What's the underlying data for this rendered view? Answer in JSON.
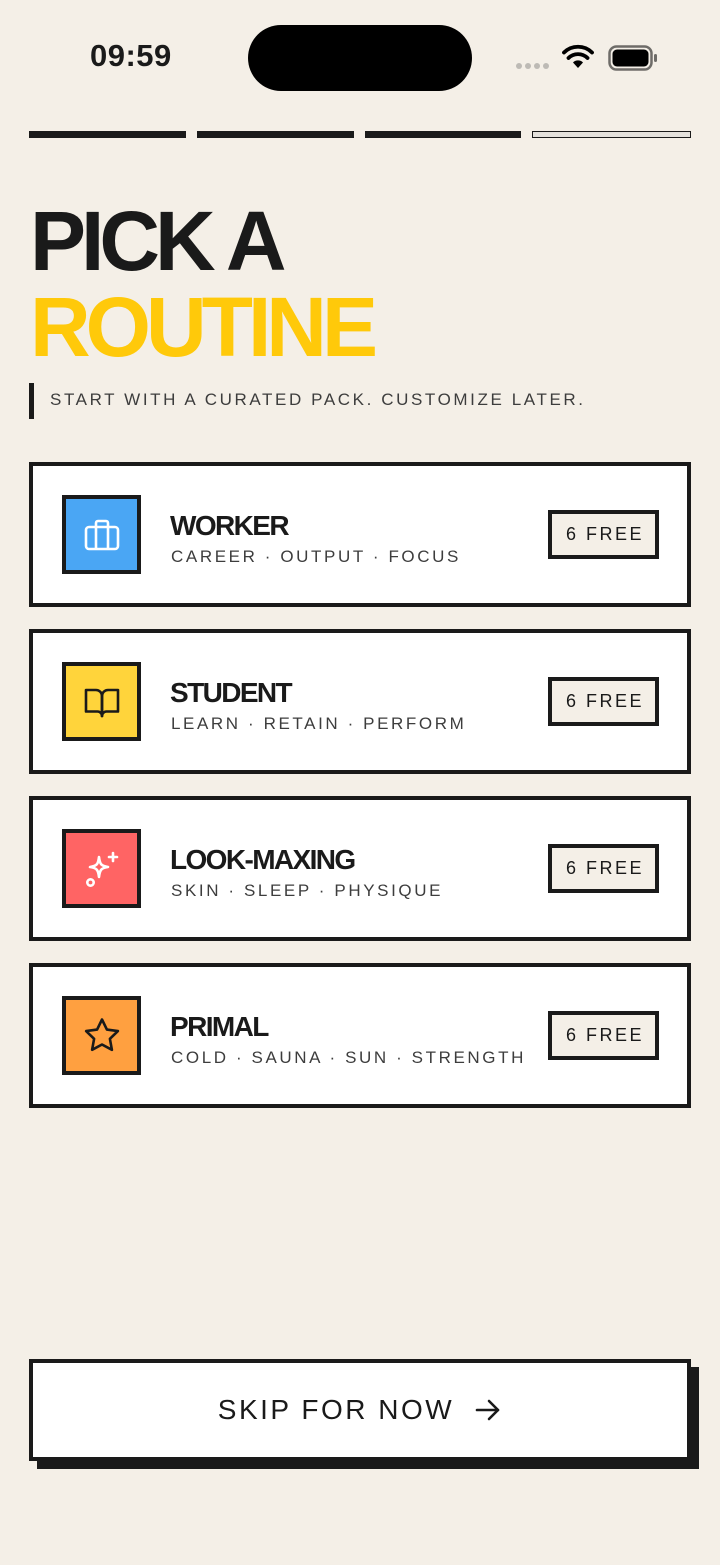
{
  "status_bar": {
    "time": "09:59"
  },
  "progress": {
    "total_steps": 4,
    "completed_steps": 3
  },
  "header": {
    "title_line1": "PICK A",
    "title_line2": "ROUTINE",
    "subtitle": "START WITH A CURATED PACK. CUSTOMIZE LATER."
  },
  "routines": [
    {
      "name": "WORKER",
      "tags": "CAREER · OUTPUT · FOCUS",
      "badge": "6 FREE",
      "icon": "briefcase-icon",
      "color": "#4aa6f4"
    },
    {
      "name": "STUDENT",
      "tags": "LEARN · RETAIN · PERFORM",
      "badge": "6 FREE",
      "icon": "book-icon",
      "color": "#ffd43b"
    },
    {
      "name": "LOOK-MAXING",
      "tags": "SKIN · SLEEP · PHYSIQUE",
      "badge": "6 FREE",
      "icon": "sparkles-icon",
      "color": "#ff6464"
    },
    {
      "name": "PRIMAL",
      "tags": "COLD · SAUNA · SUN · STRENGTH",
      "badge": "6 FREE",
      "icon": "star-icon",
      "color": "#ffa040"
    }
  ],
  "skip_button": {
    "label": "SKIP FOR NOW",
    "icon": "arrow-right-icon"
  },
  "colors": {
    "background": "#f4efe7",
    "accent": "#ffc90a",
    "ink": "#1a1a1a"
  }
}
